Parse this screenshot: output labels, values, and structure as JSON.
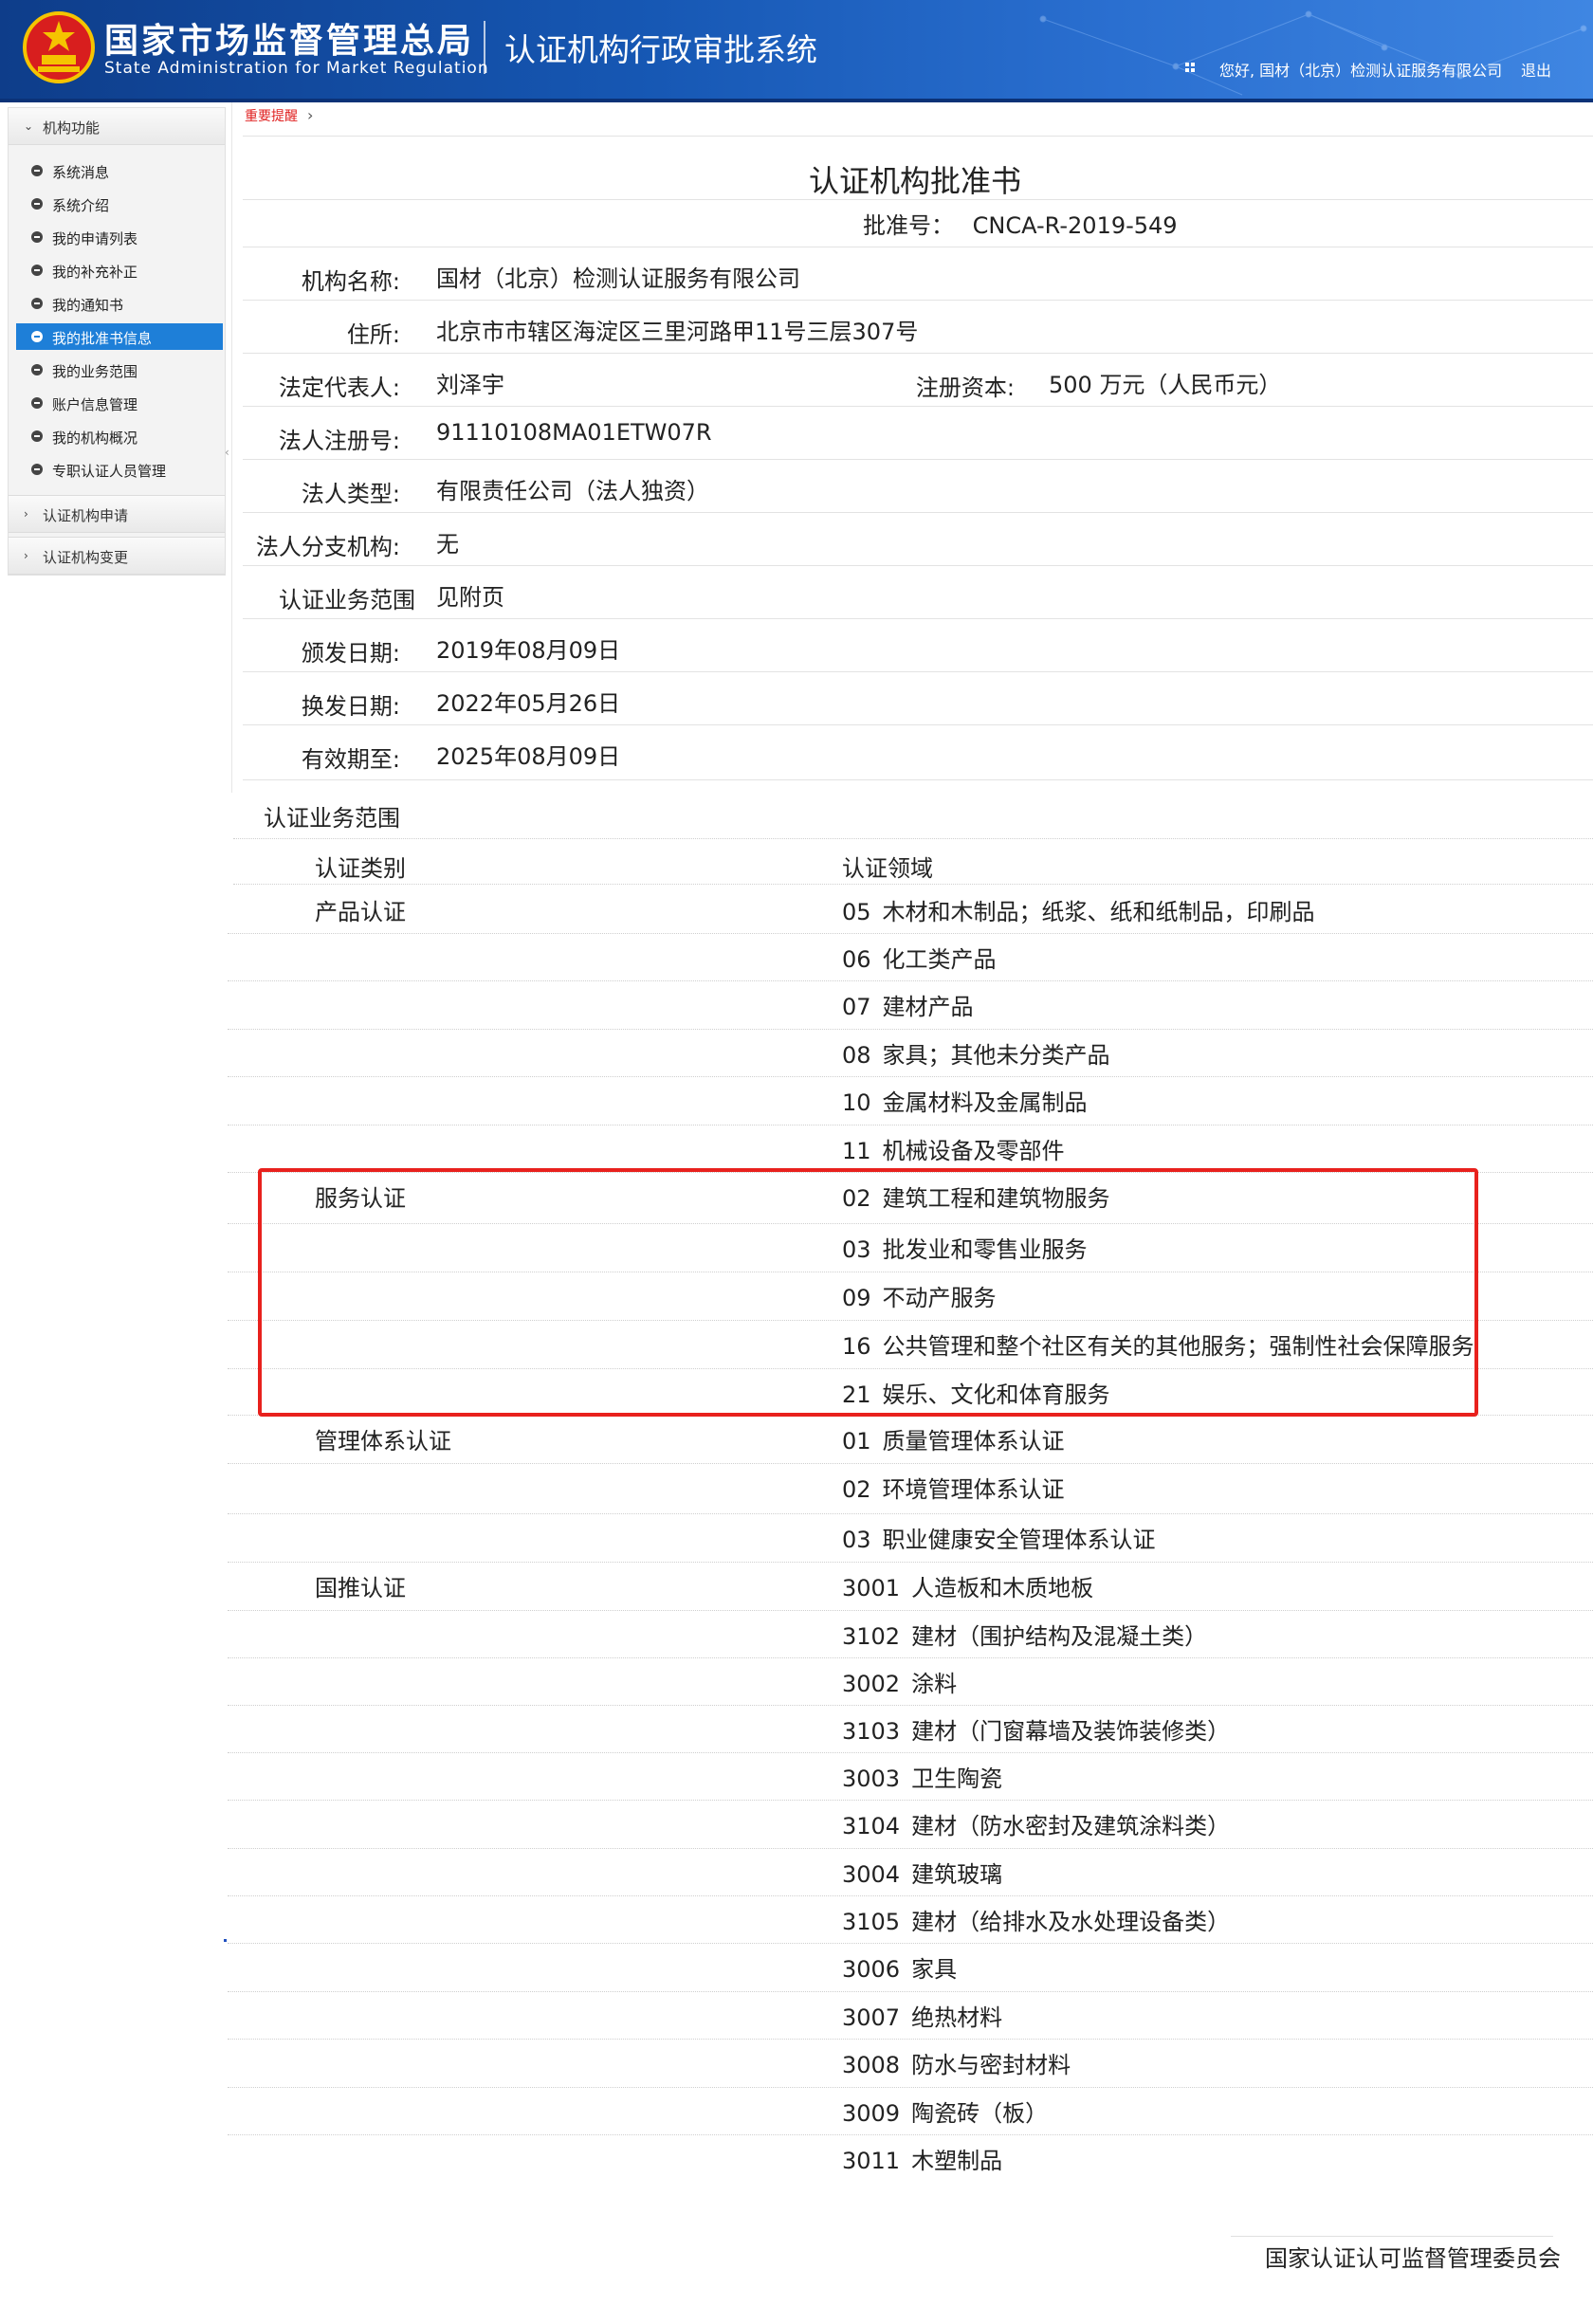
{
  "header": {
    "org_cn": "国家市场监督管理总局",
    "org_en": "State Administration  for  Market Regulation",
    "system_title": "认证机构行政审批系统",
    "greeting": "您好, 国材（北京）检测认证服务有限公司",
    "logout": "退出"
  },
  "sidebar": {
    "section_main": "机构功能",
    "items": [
      {
        "label": "系统消息",
        "active": false
      },
      {
        "label": "系统介绍",
        "active": false
      },
      {
        "label": "我的申请列表",
        "active": false
      },
      {
        "label": "我的补充补正",
        "active": false
      },
      {
        "label": "我的通知书",
        "active": false
      },
      {
        "label": "我的批准书信息",
        "active": true
      },
      {
        "label": "我的业务范围",
        "active": false
      },
      {
        "label": "账户信息管理",
        "active": false
      },
      {
        "label": "我的机构概况",
        "active": false
      },
      {
        "label": "专职认证人员管理",
        "active": false
      }
    ],
    "section_apply": "认证机构申请",
    "section_change": "认证机构变更"
  },
  "breadcrumb": {
    "label": "重要提醒"
  },
  "document": {
    "title": "认证机构批准书",
    "approval_label": "批准号：",
    "approval_no": "CNCA-R-2019-549",
    "fields": {
      "name_label": "机构名称:",
      "name": "国材（北京）检测认证服务有限公司",
      "address_label": "住所:",
      "address": "北京市市辖区海淀区三里河路甲11号三层307号",
      "legal_rep_label": "法定代表人:",
      "legal_rep": "刘泽宇",
      "capital_label": "注册资本:",
      "capital": "500 万元（人民币元）",
      "reg_no_label": "法人注册号:",
      "reg_no": "91110108MA01ETW07R",
      "type_label": "法人类型:",
      "type": "有限责任公司（法人独资）",
      "branch_label": "法人分支机构:",
      "branch": "无",
      "scope_label": "认证业务范围",
      "scope": "见附页",
      "issue_label": "颁发日期:",
      "issue_date": "2019年08月09日",
      "renew_label": "换发日期:",
      "renew_date": "2022年05月26日",
      "expire_label": "有效期至:",
      "expire_date": "2025年08月09日"
    },
    "scope_table": {
      "section_title": "认证业务范围",
      "col_category": "认证类别",
      "col_field": "认证领域",
      "rows": [
        {
          "category": "产品认证",
          "code": "05",
          "name": "木材和木制品；纸浆、纸和纸制品，印刷品"
        },
        {
          "category": "",
          "code": "06",
          "name": "化工类产品"
        },
        {
          "category": "",
          "code": "07",
          "name": "建材产品"
        },
        {
          "category": "",
          "code": "08",
          "name": "家具；其他未分类产品"
        },
        {
          "category": "",
          "code": "10",
          "name": "金属材料及金属制品"
        },
        {
          "category": "",
          "code": "11",
          "name": "机械设备及零部件"
        },
        {
          "category": "服务认证",
          "code": "02",
          "name": "建筑工程和建筑物服务"
        },
        {
          "category": "",
          "code": "03",
          "name": "批发业和零售业服务"
        },
        {
          "category": "",
          "code": "09",
          "name": "不动产服务"
        },
        {
          "category": "",
          "code": "16",
          "name": "公共管理和整个社区有关的其他服务；强制性社会保障服务"
        },
        {
          "category": "",
          "code": "21",
          "name": "娱乐、文化和体育服务"
        },
        {
          "category": "管理体系认证",
          "code": "01",
          "name": "质量管理体系认证"
        },
        {
          "category": "",
          "code": "02",
          "name": "环境管理体系认证"
        },
        {
          "category": "",
          "code": "03",
          "name": "职业健康安全管理体系认证"
        },
        {
          "category": "国推认证",
          "code": "3001",
          "name": "人造板和木质地板"
        },
        {
          "category": "",
          "code": "3102",
          "name": "建材（围护结构及混凝土类）"
        },
        {
          "category": "",
          "code": "3002",
          "name": "涂料"
        },
        {
          "category": "",
          "code": "3103",
          "name": "建材（门窗幕墙及装饰装修类）"
        },
        {
          "category": "",
          "code": "3003",
          "name": "卫生陶瓷"
        },
        {
          "category": "",
          "code": "3104",
          "name": "建材（防水密封及建筑涂料类）"
        },
        {
          "category": "",
          "code": "3004",
          "name": "建筑玻璃"
        },
        {
          "category": "",
          "code": "3105",
          "name": "建材（给排水及水处理设备类）"
        },
        {
          "category": "",
          "code": "3006",
          "name": "家具"
        },
        {
          "category": "",
          "code": "3007",
          "name": "绝热材料"
        },
        {
          "category": "",
          "code": "3008",
          "name": "防水与密封材料"
        },
        {
          "category": "",
          "code": "3009",
          "name": "陶瓷砖（板）"
        },
        {
          "category": "",
          "code": "3011",
          "name": "木塑制品"
        }
      ]
    },
    "footer_sign": "国家认证认可监督管理委员会"
  },
  "colors": {
    "header_blue": "#1657b3",
    "active_blue": "#1e7fd8",
    "highlight_red": "#e8211d",
    "breadcrumb_red": "#e02020"
  }
}
